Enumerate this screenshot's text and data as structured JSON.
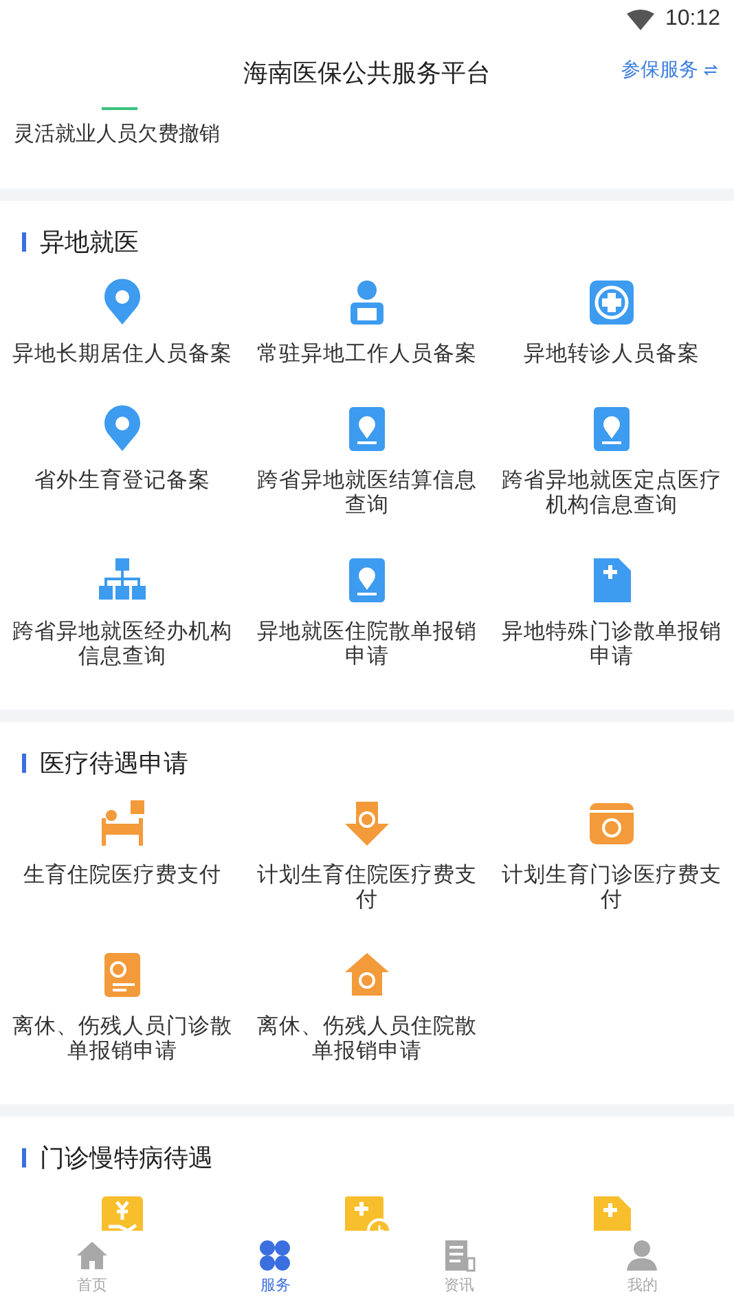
{
  "status_bar": {
    "time": "10:12"
  },
  "header": {
    "title": "海南医保公共服务平台",
    "action": "参保服务"
  },
  "partial_item": {
    "label": "灵活就业人员欠费撤销"
  },
  "sections": [
    {
      "title": "异地就医",
      "items": [
        {
          "label": "异地长期居住人员备案"
        },
        {
          "label": "常驻异地工作人员备案"
        },
        {
          "label": "异地转诊人员备案"
        },
        {
          "label": "省外生育登记备案"
        },
        {
          "label": "跨省异地就医结算信息查询"
        },
        {
          "label": "跨省异地就医定点医疗机构信息查询"
        },
        {
          "label": "跨省异地就医经办机构信息查询"
        },
        {
          "label": "异地就医住院散单报销申请"
        },
        {
          "label": "异地特殊门诊散单报销申请"
        }
      ]
    },
    {
      "title": "医疗待遇申请",
      "items": [
        {
          "label": "生育住院医疗费支付"
        },
        {
          "label": "计划生育住院医疗费支付"
        },
        {
          "label": "计划生育门诊医疗费支付"
        },
        {
          "label": "离休、伤残人员门诊散单报销申请"
        },
        {
          "label": "离休、伤残人员住院散单报销申请"
        }
      ]
    },
    {
      "title": "门诊慢特病待遇",
      "items": [
        {
          "kind": "icon_only"
        },
        {
          "kind": "icon_only"
        },
        {
          "kind": "icon_only"
        }
      ]
    }
  ],
  "nav": [
    {
      "label": "首页",
      "selected": false
    },
    {
      "label": "服务",
      "selected": true
    },
    {
      "label": "资讯",
      "selected": false
    },
    {
      "label": "我的",
      "selected": false
    }
  ]
}
